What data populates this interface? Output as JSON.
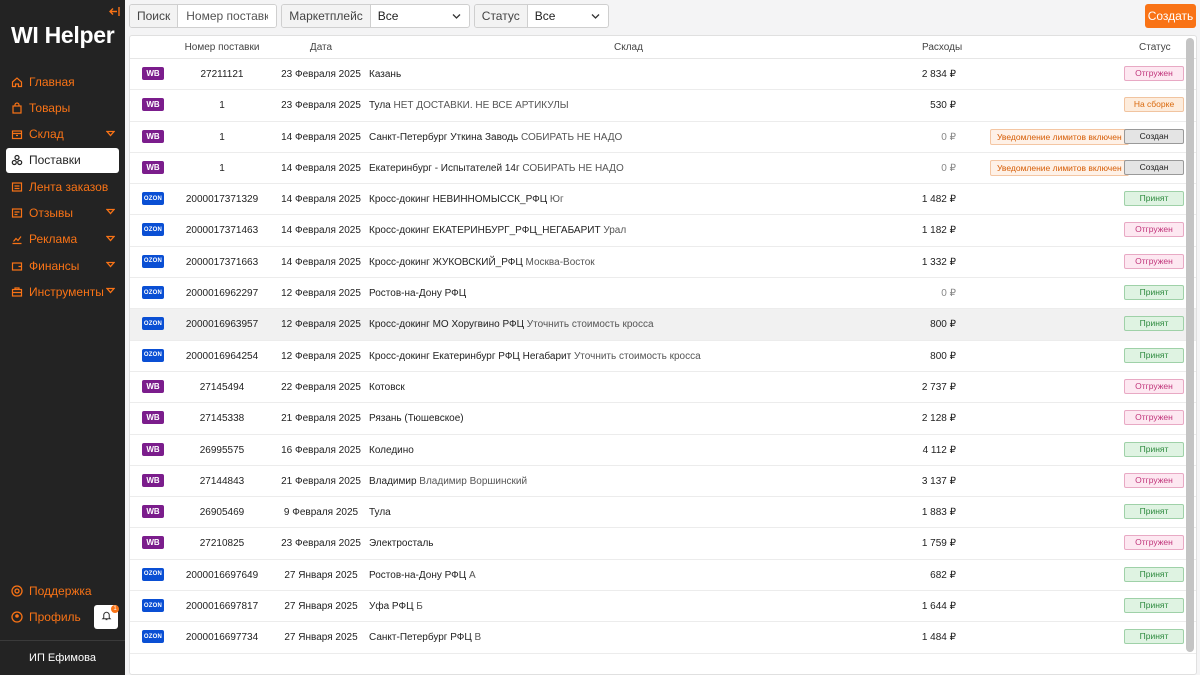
{
  "app": {
    "title": "WI Helper",
    "org": "ИП Ефимова",
    "notif_count": "1"
  },
  "sidebar": {
    "items": [
      {
        "label": "Главная",
        "icon": "home-icon",
        "active": false,
        "expandable": false
      },
      {
        "label": "Товары",
        "icon": "bag-icon",
        "active": false,
        "expandable": false
      },
      {
        "label": "Склад",
        "icon": "box-icon",
        "active": false,
        "expandable": true
      },
      {
        "label": "Поставки",
        "icon": "boxes-icon",
        "active": true,
        "expandable": false
      },
      {
        "label": "Лента заказов",
        "icon": "list-icon",
        "active": false,
        "expandable": false
      },
      {
        "label": "Отзывы",
        "icon": "message-icon",
        "active": false,
        "expandable": true
      },
      {
        "label": "Реклама",
        "icon": "chart-icon",
        "active": false,
        "expandable": true
      },
      {
        "label": "Финансы",
        "icon": "wallet-icon",
        "active": false,
        "expandable": true
      },
      {
        "label": "Инструменты",
        "icon": "tools-icon",
        "active": false,
        "expandable": true
      }
    ],
    "support": "Поддержка",
    "profile": "Профиль"
  },
  "filters": {
    "search_label": "Поиск",
    "search_placeholder": "Номер поставки",
    "marketplace_label": "Маркетплейс",
    "marketplace_value": "Все",
    "status_label": "Статус",
    "status_value": "Все",
    "create_label": "Создать"
  },
  "table": {
    "headers": {
      "number": "Номер поставки",
      "date": "Дата",
      "warehouse": "Склад",
      "cost": "Расходы",
      "status": "Статус"
    },
    "rows": [
      {
        "mp": "wb",
        "mp_label": "WB",
        "number": "27211121",
        "date": "23 Февраля 2025",
        "warehouse": "Казань",
        "note": "",
        "cost": "2 834 ₽",
        "notice": "",
        "status": "Отгружен",
        "st": "otgr"
      },
      {
        "mp": "wb",
        "mp_label": "WB",
        "number": "1",
        "date": "23 Февраля 2025",
        "warehouse": "Тула",
        "note": "НЕТ ДОСТАВКИ. НЕ ВСЕ АРТИКУЛЫ",
        "cost": "530 ₽",
        "notice": "",
        "status": "На сборке",
        "st": "sbor"
      },
      {
        "mp": "wb",
        "mp_label": "WB",
        "number": "1",
        "date": "14 Февраля 2025",
        "warehouse": "Санкт-Петербург Уткина Заводь",
        "note": "СОБИРАТЬ НЕ НАДО",
        "cost": "0 ₽",
        "notice": "Уведомление лимитов включен",
        "status": "Создан",
        "st": "soz"
      },
      {
        "mp": "wb",
        "mp_label": "WB",
        "number": "1",
        "date": "14 Февраля 2025",
        "warehouse": "Екатеринбург - Испытателей 14г",
        "note": "СОБИРАТЬ НЕ НАДО",
        "cost": "0 ₽",
        "notice": "Уведомление лимитов включен",
        "status": "Создан",
        "st": "soz"
      },
      {
        "mp": "ozon",
        "mp_label": "OZON",
        "number": "2000017371329",
        "date": "14 Февраля 2025",
        "warehouse": "Кросс-докинг НЕВИННОМЫССК_РФЦ",
        "note": "Юг",
        "cost": "1 482 ₽",
        "notice": "",
        "status": "Принят",
        "st": "prin"
      },
      {
        "mp": "ozon",
        "mp_label": "OZON",
        "number": "2000017371463",
        "date": "14 Февраля 2025",
        "warehouse": "Кросс-докинг ЕКАТЕРИНБУРГ_РФЦ_НЕГАБАРИТ",
        "note": "Урал",
        "cost": "1 182 ₽",
        "notice": "",
        "status": "Отгружен",
        "st": "otgr"
      },
      {
        "mp": "ozon",
        "mp_label": "OZON",
        "number": "2000017371663",
        "date": "14 Февраля 2025",
        "warehouse": "Кросс-докинг ЖУКОВСКИЙ_РФЦ",
        "note": "Москва-Восток",
        "cost": "1 332 ₽",
        "notice": "",
        "status": "Отгружен",
        "st": "otgr"
      },
      {
        "mp": "ozon",
        "mp_label": "OZON",
        "number": "2000016962297",
        "date": "12 Февраля 2025",
        "warehouse": "Ростов-на-Дону РФЦ",
        "note": "",
        "cost": "0 ₽",
        "notice": "",
        "status": "Принят",
        "st": "prin"
      },
      {
        "mp": "ozon",
        "mp_label": "OZON",
        "number": "2000016963957",
        "date": "12 Февраля 2025",
        "warehouse": "Кросс-докинг МО Хоругвино РФЦ",
        "note": "Уточнить стоимость кросса",
        "cost": "800 ₽",
        "notice": "",
        "status": "Принят",
        "st": "prin",
        "hl": true
      },
      {
        "mp": "ozon",
        "mp_label": "OZON",
        "number": "2000016964254",
        "date": "12 Февраля 2025",
        "warehouse": "Кросс-докинг Екатеринбург РФЦ Негабарит",
        "note": "Уточнить стоимость кросса",
        "cost": "800 ₽",
        "notice": "",
        "status": "Принят",
        "st": "prin"
      },
      {
        "mp": "wb",
        "mp_label": "WB",
        "number": "27145494",
        "date": "22 Февраля 2025",
        "warehouse": "Котовск",
        "note": "",
        "cost": "2 737 ₽",
        "notice": "",
        "status": "Отгружен",
        "st": "otgr"
      },
      {
        "mp": "wb",
        "mp_label": "WB",
        "number": "27145338",
        "date": "21 Февраля 2025",
        "warehouse": "Рязань (Тюшевское)",
        "note": "",
        "cost": "2 128 ₽",
        "notice": "",
        "status": "Отгружен",
        "st": "otgr"
      },
      {
        "mp": "wb",
        "mp_label": "WB",
        "number": "26995575",
        "date": "16 Февраля 2025",
        "warehouse": "Коледино",
        "note": "",
        "cost": "4 112 ₽",
        "notice": "",
        "status": "Принят",
        "st": "prin"
      },
      {
        "mp": "wb",
        "mp_label": "WB",
        "number": "27144843",
        "date": "21 Февраля 2025",
        "warehouse": "Владимир",
        "note": "Владимир Воршинский",
        "cost": "3 137 ₽",
        "notice": "",
        "status": "Отгружен",
        "st": "otgr"
      },
      {
        "mp": "wb",
        "mp_label": "WB",
        "number": "26905469",
        "date": "9 Февраля 2025",
        "warehouse": "Тула",
        "note": "",
        "cost": "1 883 ₽",
        "notice": "",
        "status": "Принят",
        "st": "prin"
      },
      {
        "mp": "wb",
        "mp_label": "WB",
        "number": "27210825",
        "date": "23 Февраля 2025",
        "warehouse": "Электросталь",
        "note": "",
        "cost": "1 759 ₽",
        "notice": "",
        "status": "Отгружен",
        "st": "otgr"
      },
      {
        "mp": "ozon",
        "mp_label": "OZON",
        "number": "2000016697649",
        "date": "27 Января 2025",
        "warehouse": "Ростов-на-Дону РФЦ",
        "note": "А",
        "cost": "682 ₽",
        "notice": "",
        "status": "Принят",
        "st": "prin"
      },
      {
        "mp": "ozon",
        "mp_label": "OZON",
        "number": "2000016697817",
        "date": "27 Января 2025",
        "warehouse": "Уфа РФЦ",
        "note": "Б",
        "cost": "1 644 ₽",
        "notice": "",
        "status": "Принят",
        "st": "prin"
      },
      {
        "mp": "ozon",
        "mp_label": "OZON",
        "number": "2000016697734",
        "date": "27 Января 2025",
        "warehouse": "Санкт-Петербург РФЦ",
        "note": "В",
        "cost": "1 484 ₽",
        "notice": "",
        "status": "Принят",
        "st": "prin"
      }
    ]
  },
  "colors": {
    "accent": "#f97316",
    "sidebar_bg": "#232323",
    "wb": "#7b1d8c",
    "ozon": "#0a4fd4"
  }
}
